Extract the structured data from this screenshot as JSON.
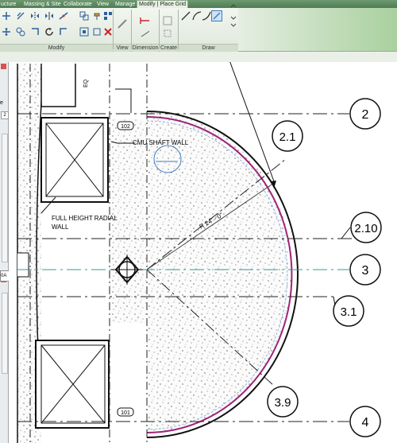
{
  "ribbon": {
    "tabs": [
      {
        "label": "ucture"
      },
      {
        "label": "Massing & Site"
      },
      {
        "label": "Collaborate"
      },
      {
        "label": "View"
      },
      {
        "label": "Manage"
      },
      {
        "label": "Modify | Place Grid",
        "active": true
      }
    ],
    "panels": {
      "modify": "Modify",
      "view": "View",
      "dimension": "Dimension",
      "create": "Create",
      "draw": "Draw"
    }
  },
  "left_panel": {
    "field": "e",
    "spinner": "2",
    "tag": "0A"
  },
  "drawing": {
    "grid_labels": [
      "2",
      "2.1",
      "2.10",
      "3",
      "3.1",
      "3.9",
      "4"
    ],
    "room_tags": [
      "102",
      "101"
    ],
    "notes": {
      "cmu": "CMU SHAFT WALL",
      "radial_line1": "FULL HEIGHT RADIAL",
      "radial_line2": "WALL",
      "radius": "R 24' - 0\"",
      "eq": "EQ"
    }
  },
  "colors": {
    "ribbon_tab_bg": "#4d7d52",
    "grid_line": "#222222",
    "wall_highlight": "#a0237a",
    "inner_highlight": "#8fb5d6",
    "selected_tool": "#3a7dbd"
  }
}
